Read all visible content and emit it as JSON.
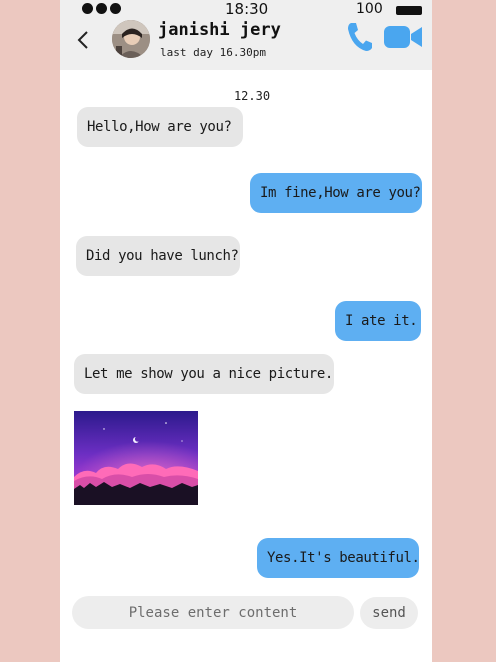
{
  "status_bar": {
    "time": "18:30",
    "battery": "100"
  },
  "header": {
    "back_icon": "chevron-left-icon",
    "contact_name": "janishi jery",
    "last_seen": "last day 16.30pm",
    "call_icon": "phone-icon",
    "video_icon": "video-camera-icon",
    "accent_color": "#4aa6ef"
  },
  "chat": {
    "time_separator": "12.30",
    "messages": [
      {
        "direction": "incoming",
        "text": "Hello,How are you?"
      },
      {
        "direction": "outgoing",
        "text": "Im fine,How are you?"
      },
      {
        "direction": "incoming",
        "text": "Did you have lunch?"
      },
      {
        "direction": "outgoing",
        "text": "I ate it."
      },
      {
        "direction": "incoming",
        "text": "Let me show you a nice picture."
      },
      {
        "direction": "incoming",
        "type": "image"
      },
      {
        "direction": "outgoing",
        "text": "Yes.It's beautiful."
      }
    ],
    "incoming_color": "#e6e6e6",
    "outgoing_color": "#5eaff2"
  },
  "input": {
    "placeholder": "Please enter content",
    "value": "",
    "send_label": "send"
  }
}
